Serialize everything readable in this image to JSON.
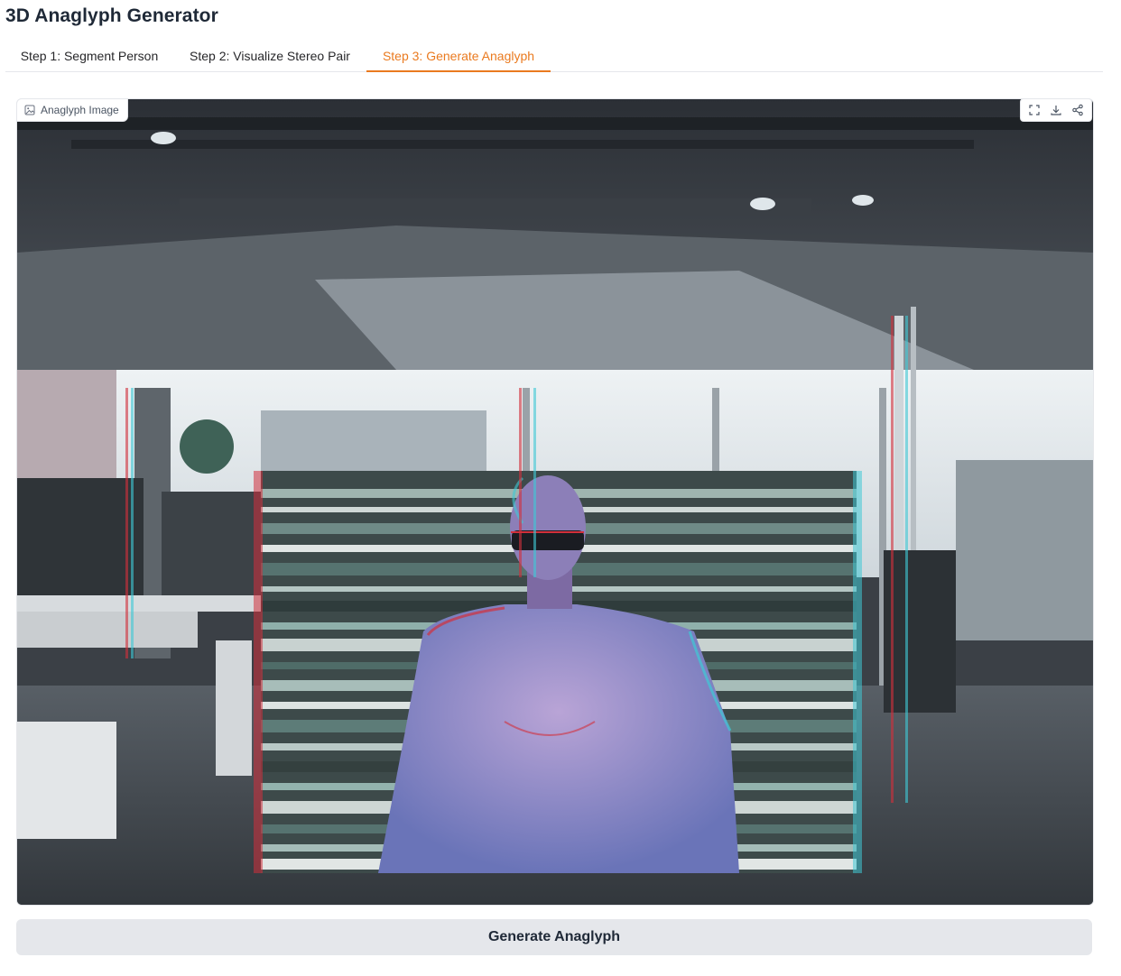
{
  "app": {
    "title": "3D Anaglyph Generator"
  },
  "tabs": [
    {
      "label": "Step 1: Segment Person",
      "active": false
    },
    {
      "label": "Step 2: Visualize Stereo Pair",
      "active": false
    },
    {
      "label": "Step 3: Generate Anaglyph",
      "active": true
    }
  ],
  "image_panel": {
    "label": "Anaglyph Image",
    "label_icon": "image-icon",
    "actions": [
      {
        "name": "fullscreen",
        "icon": "fullscreen-icon"
      },
      {
        "name": "download",
        "icon": "download-icon"
      },
      {
        "name": "share",
        "icon": "share-icon"
      }
    ]
  },
  "actions": {
    "generate_label": "Generate Anaglyph"
  },
  "colors": {
    "accent": "#ea7a1f",
    "button_bg": "#e5e7eb",
    "border": "#e5e7eb",
    "anaglyph_red": "#d2303c",
    "anaglyph_cyan": "#3fc9d6"
  }
}
